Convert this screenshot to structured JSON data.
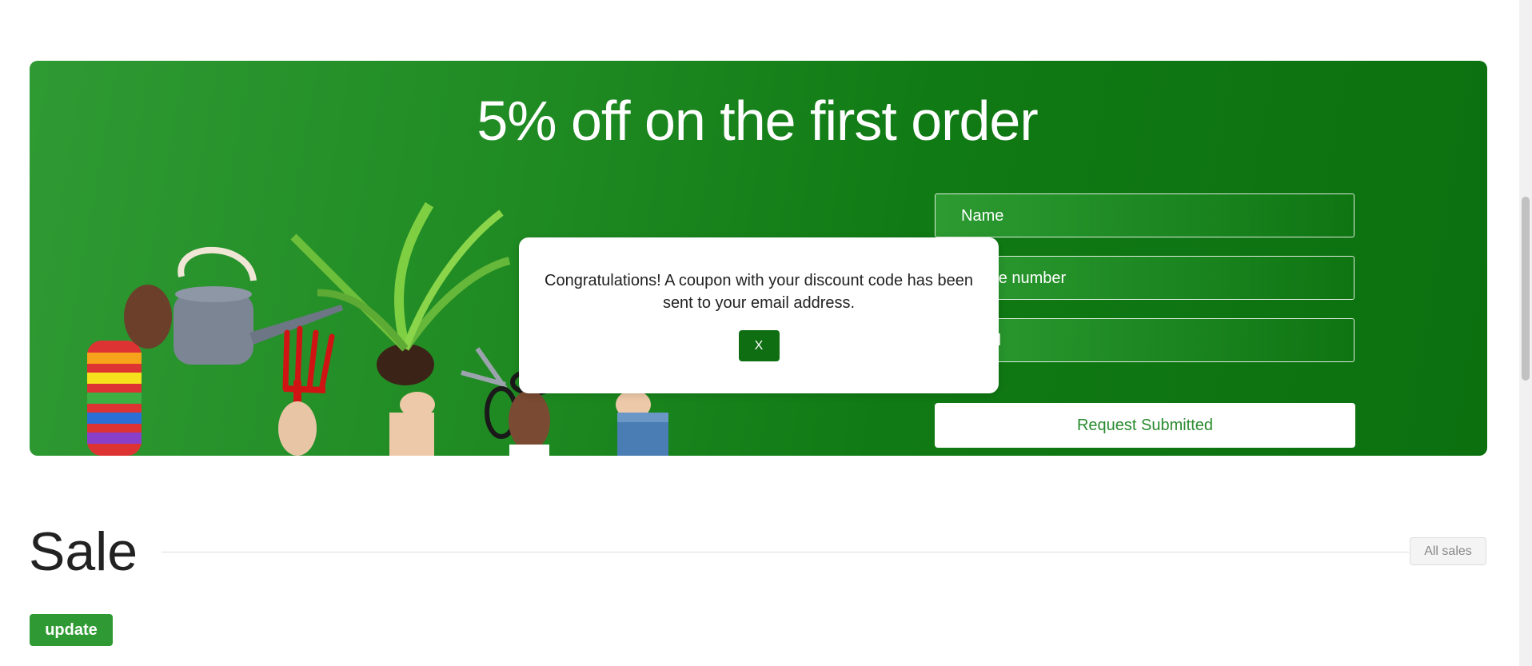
{
  "promo": {
    "title": "5% off on the first order",
    "fields": {
      "name_placeholder": "Name",
      "phone_placeholder": "Phone number",
      "email_placeholder": "Email"
    },
    "submit_label": "Request Submitted",
    "colors": {
      "banner_start": "#2f9a33",
      "banner_end": "#0c700f",
      "submit_text": "#2a8a2e"
    },
    "illustration_icons": [
      "rainbow-sleeve-icon",
      "watering-can-icon",
      "garden-fork-icon",
      "potted-fern-icon",
      "pruning-shears-icon",
      "denim-sleeve-icon"
    ]
  },
  "modal": {
    "message": "Congratulations! A coupon with your discount code has been sent to your email address.",
    "close_label": "X",
    "close_color": "#0f6e12"
  },
  "sale": {
    "heading": "Sale",
    "all_sales_label": "All sales",
    "update_label": "update",
    "update_color": "#2f9a33"
  }
}
